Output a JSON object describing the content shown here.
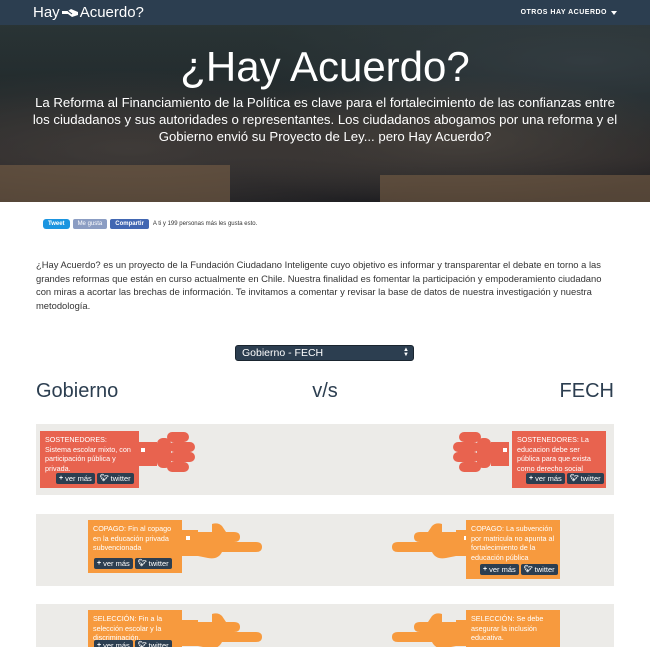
{
  "navbar": {
    "brand_left": "Hay",
    "brand_right": "Acuerdo?",
    "menu_label": "OTROS HAY ACUERDO"
  },
  "hero": {
    "title": "¿Hay Acuerdo?",
    "text": "La Reforma al Financiamiento de la Política es clave para el fortalecimiento de las confianzas entre los ciudadanos y sus autoridades o representantes. Los ciudadanos abogamos por una reforma y el Gobierno envió su Proyecto de Ley... pero Hay Acuerdo?"
  },
  "social": {
    "tweet": "Tweet",
    "like": "Me gusta",
    "share": "Compartir",
    "count": "A ti y 199 personas más les gusta esto."
  },
  "intro": "¿Hay Acuerdo? es un proyecto de la Fundación Ciudadano Inteligente cuyo objetivo es informar y transparentar el debate en torno a las grandes reformas que están en curso actualmente en Chile. Nuestra finalidad es fomentar la participación y empoderamiento ciudadano con miras a acortar las brechas de información. Te invitamos a comentar y revisar la base de datos de nuestra investigación y nuestra metodología.",
  "selector": {
    "value": "Gobierno - FECH"
  },
  "versus": {
    "left": "Gobierno",
    "middle": "v/s",
    "right": "FECH"
  },
  "buttons": {
    "more": "ver más",
    "twitter": "twitter"
  },
  "rows": [
    {
      "color": "#e8634f",
      "left": "SOSTENEDORES: Sistema escolar mixto, con participación pública y privada.",
      "right": "SOSTENEDORES: La educacion debe ser pública para que exista como derecho social"
    },
    {
      "color": "#f79a3e",
      "left": "COPAGO: Fin al copago en la educación privada subvencionada",
      "right": "COPAGO: La subvención por matricula no apunta al fortalecimiento de la educación pública"
    },
    {
      "color": "#f79a3e",
      "left": "SELECCIÓN: Fin a la selección escolar y la discriminación.",
      "right": "SELECCIÓN: Se debe asegurar la inclusión educativa."
    }
  ]
}
